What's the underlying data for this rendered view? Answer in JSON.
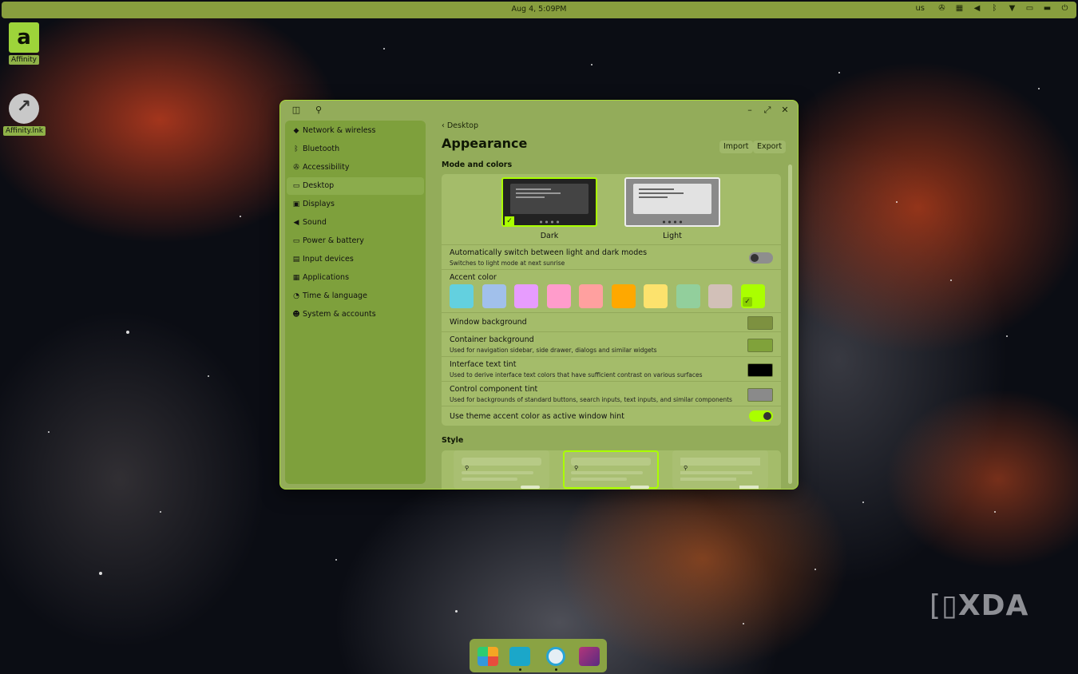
{
  "top_panel": {
    "clock": "Aug 4, 5:09PM",
    "keyboard_layout": "us",
    "tray_icons": [
      "accessibility-icon",
      "network-icon",
      "volume-icon",
      "bluetooth-icon",
      "wifi-icon",
      "battery-icon",
      "notifications-icon",
      "power-icon"
    ]
  },
  "desktop": {
    "icons": [
      {
        "label": "Affinity"
      },
      {
        "label": "Affinity.lnk"
      }
    ]
  },
  "settings": {
    "sidebar": {
      "items": [
        {
          "label": "Network & wireless",
          "icon": "network-icon"
        },
        {
          "label": "Bluetooth",
          "icon": "bluetooth-icon"
        },
        {
          "label": "Accessibility",
          "icon": "accessibility-icon"
        },
        {
          "label": "Desktop",
          "icon": "desktop-icon",
          "active": true
        },
        {
          "label": "Displays",
          "icon": "displays-icon"
        },
        {
          "label": "Sound",
          "icon": "sound-icon"
        },
        {
          "label": "Power & battery",
          "icon": "battery-icon"
        },
        {
          "label": "Input devices",
          "icon": "keyboard-icon"
        },
        {
          "label": "Applications",
          "icon": "apps-icon"
        },
        {
          "label": "Time & language",
          "icon": "time-icon"
        },
        {
          "label": "System & accounts",
          "icon": "users-icon"
        }
      ]
    },
    "page": {
      "back_label": "Desktop",
      "title": "Appearance",
      "import_label": "Import",
      "export_label": "Export",
      "mode_section": "Mode and colors",
      "modes": [
        {
          "label": "Dark",
          "selected": true
        },
        {
          "label": "Light",
          "selected": false
        }
      ],
      "auto_switch": {
        "title": "Automatically switch between light and dark modes",
        "subtitle": "Switches to light mode at next sunrise",
        "enabled": false
      },
      "accent": {
        "title": "Accent color",
        "colors": [
          "#63d0df",
          "#a1c0eb",
          "#e79cfe",
          "#ff9ccb",
          "#ffa09f",
          "#ffa800",
          "#fce26d",
          "#92cf9c",
          "#d2c0b8",
          "#aaff00"
        ],
        "selected_index": 9
      },
      "window_background": {
        "title": "Window background",
        "color": "#7d9140"
      },
      "container_background": {
        "title": "Container background",
        "subtitle": "Used for navigation sidebar, side drawer, dialogs and similar widgets",
        "color": "#80a23a"
      },
      "text_tint": {
        "title": "Interface text tint",
        "subtitle": "Used to derive interface text colors that have sufficient contrast on various surfaces",
        "color": "#000000"
      },
      "control_tint": {
        "title": "Control component tint",
        "subtitle": "Used for backgrounds of standard buttons, search inputs, text inputs, and similar components",
        "color": "#8a8a8a"
      },
      "accent_hint": {
        "title": "Use theme accent color as active window hint",
        "enabled": true
      },
      "style_section": "Style"
    }
  },
  "dock": {
    "items": [
      "launcher-icon",
      "files-icon",
      "store-icon",
      "terminal-icon"
    ]
  },
  "watermark": "XDA"
}
